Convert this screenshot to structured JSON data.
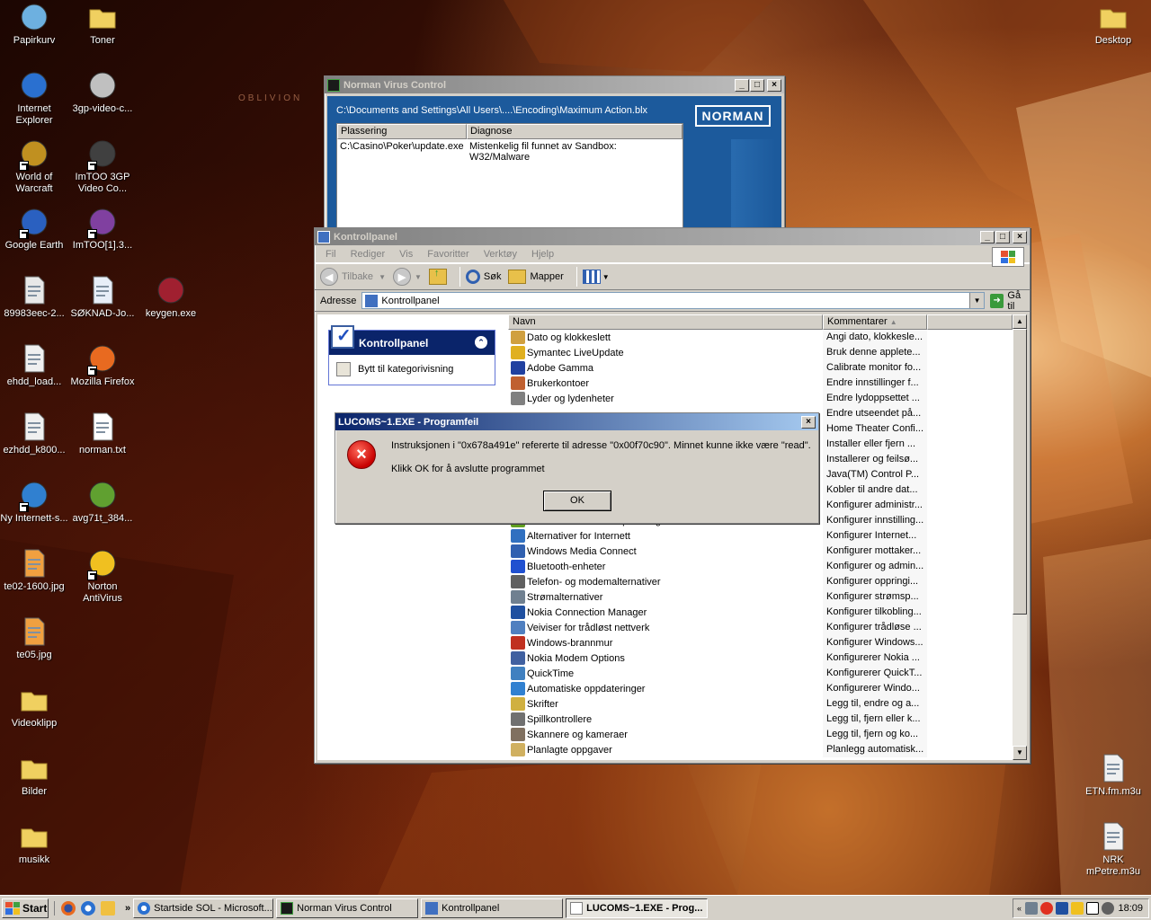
{
  "desktop": {
    "wallpaper_text": "OBLIVION",
    "icons": [
      {
        "label": "Papirkurv",
        "icon": "recycle-bin-icon"
      },
      {
        "label": "Toner",
        "icon": "folder-icon"
      },
      {
        "label": "Internet Explorer",
        "icon": "internet-explorer-icon"
      },
      {
        "label": "3gp-video-c...",
        "icon": "disc-installer-icon"
      },
      {
        "label": "World of Warcraft",
        "icon": "world-of-warcraft-icon"
      },
      {
        "label": "ImTOO 3GP Video Co...",
        "icon": "phone-converter-icon"
      },
      {
        "label": "Google Earth",
        "icon": "google-earth-icon"
      },
      {
        "label": "ImTOO[1].3...",
        "icon": "archive-icon"
      },
      {
        "label": "89983eec-2...",
        "icon": "pdf-icon"
      },
      {
        "label": "SØKNAD-Jo...",
        "icon": "word-document-icon"
      },
      {
        "label": "keygen.exe",
        "icon": "keygen-icon"
      },
      {
        "label": "ehdd_load...",
        "icon": "disc-image-icon"
      },
      {
        "label": "Mozilla Firefox",
        "icon": "firefox-icon"
      },
      {
        "label": "ezhdd_k800...",
        "icon": "disc-image-icon"
      },
      {
        "label": "norman.txt",
        "icon": "text-file-icon"
      },
      {
        "label": "Ny Internett-s...",
        "icon": "internet-connection-icon"
      },
      {
        "label": "avg71t_384...",
        "icon": "avg-installer-icon"
      },
      {
        "label": "te02-1600.jpg",
        "icon": "image-file-icon"
      },
      {
        "label": "Norton AntiVirus",
        "icon": "norton-antivirus-icon"
      },
      {
        "label": "te05.jpg",
        "icon": "image-file-icon"
      },
      {
        "label": "Videoklipp",
        "icon": "folder-icon"
      },
      {
        "label": "Bilder",
        "icon": "folder-icon"
      },
      {
        "label": "musikk",
        "icon": "folder-icon"
      },
      {
        "label": "Desktop",
        "icon": "folder-icon"
      },
      {
        "label": "ETN.fm.m3u",
        "icon": "playlist-file-icon"
      },
      {
        "label": "NRK mPetre.m3u",
        "icon": "playlist-file-icon"
      }
    ]
  },
  "norman_window": {
    "title": "Norman Virus Control",
    "path": "C:\\Documents and Settings\\All Users\\....\\Encoding\\Maximum Action.blx",
    "logo": "NORMAN",
    "columns": [
      "Plassering",
      "Diagnose"
    ],
    "rows": [
      {
        "location": "C:\\Casino\\Poker\\update.exe",
        "diagnosis": "Mistenkelig fil funnet av Sandbox: W32/Malware"
      }
    ]
  },
  "control_panel": {
    "title": "Kontrollpanel",
    "menu": [
      "Fil",
      "Rediger",
      "Vis",
      "Favoritter",
      "Verktøy",
      "Hjelp"
    ],
    "toolbar": {
      "back": "Tilbake",
      "search": "Søk",
      "folders": "Mapper"
    },
    "address_label": "Adresse",
    "address_value": "Kontrollpanel",
    "go_label": "Gå til",
    "taskpane": {
      "title": "Kontrollpanel",
      "link": "Bytt til kategorivisning"
    },
    "columns": [
      "Navn",
      "Kommentarer"
    ],
    "items": [
      {
        "name": "Dato og klokkeslett",
        "comment": "Angi dato, klokkesle...",
        "color": "#d0a040"
      },
      {
        "name": "Symantec LiveUpdate",
        "comment": "Bruk denne applete...",
        "color": "#e0b020"
      },
      {
        "name": "Adobe Gamma",
        "comment": "Calibrate monitor fo...",
        "color": "#2040a0"
      },
      {
        "name": "Brukerkontoer",
        "comment": "Endre innstillinger f...",
        "color": "#c06030"
      },
      {
        "name": "Lyder og lydenheter",
        "comment": "Endre lydoppsettet ...",
        "color": "#808080"
      },
      {
        "name": "",
        "comment": "Endre utseendet på...",
        "color": ""
      },
      {
        "name": "",
        "comment": "Home Theater Confi...",
        "color": ""
      },
      {
        "name": "",
        "comment": "Installer eller fjern ...",
        "color": ""
      },
      {
        "name": "",
        "comment": "Installerer og feilsø...",
        "color": ""
      },
      {
        "name": "",
        "comment": "Java(TM) Control P...",
        "color": ""
      },
      {
        "name": "",
        "comment": "Kobler til andre dat...",
        "color": ""
      },
      {
        "name": "",
        "comment": "Konfigurer administr...",
        "color": ""
      },
      {
        "name": "NVIDIA nView Desktop Manager",
        "comment": "Konfigurer innstilling...",
        "color": "#60a020"
      },
      {
        "name": "Alternativer for Internett",
        "comment": "Konfigurer Internet...",
        "color": "#3070c0"
      },
      {
        "name": "Windows Media Connect",
        "comment": "Konfigurer mottaker...",
        "color": "#3060b0"
      },
      {
        "name": "Bluetooth-enheter",
        "comment": "Konfigurer og admin...",
        "color": "#2050d0"
      },
      {
        "name": "Telefon- og modemalternativer",
        "comment": "Konfigurer oppringi...",
        "color": "#606060"
      },
      {
        "name": "Strømalternativer",
        "comment": "Konfigurer strømsp...",
        "color": "#708090"
      },
      {
        "name": "Nokia Connection Manager",
        "comment": "Konfigurer tilkobling...",
        "color": "#2050a0"
      },
      {
        "name": "Veiviser for trådløst nettverk",
        "comment": "Konfigurer trådløse ...",
        "color": "#5080c0"
      },
      {
        "name": "Windows-brannmur",
        "comment": "Konfigurer Windows...",
        "color": "#c03020"
      },
      {
        "name": "Nokia Modem Options",
        "comment": "Konfigurerer Nokia ...",
        "color": "#4060a0"
      },
      {
        "name": "QuickTime",
        "comment": "Konfigurerer QuickT...",
        "color": "#4080c0"
      },
      {
        "name": "Automatiske oppdateringer",
        "comment": "Konfigurerer Windo...",
        "color": "#3080d0"
      },
      {
        "name": "Skrifter",
        "comment": "Legg til, endre og a...",
        "color": "#d0b040"
      },
      {
        "name": "Spillkontrollere",
        "comment": "Legg til, fjern eller k...",
        "color": "#707070"
      },
      {
        "name": "Skannere og kameraer",
        "comment": "Legg til, fjern og ko...",
        "color": "#807060"
      },
      {
        "name": "Planlagte oppgaver",
        "comment": "Planlegg automatisk...",
        "color": "#d0b060"
      }
    ]
  },
  "error_dialog": {
    "title": "LUCOMS~1.EXE - Programfeil",
    "message": "Instruksjonen i \"0x678a491e\" refererte til adresse \"0x00f70c90\". Minnet kunne ikke være \"read\".",
    "hint": "Klikk OK for å avslutte programmet",
    "ok_label": "OK"
  },
  "taskbar": {
    "start_label": "Start",
    "tasks": [
      {
        "label": "Startside SOL - Microsoft..."
      },
      {
        "label": "Norman Virus Control"
      },
      {
        "label": "Kontrollpanel"
      },
      {
        "label": "LUCOMS~1.EXE - Prog..."
      }
    ],
    "clock": "18:09"
  }
}
